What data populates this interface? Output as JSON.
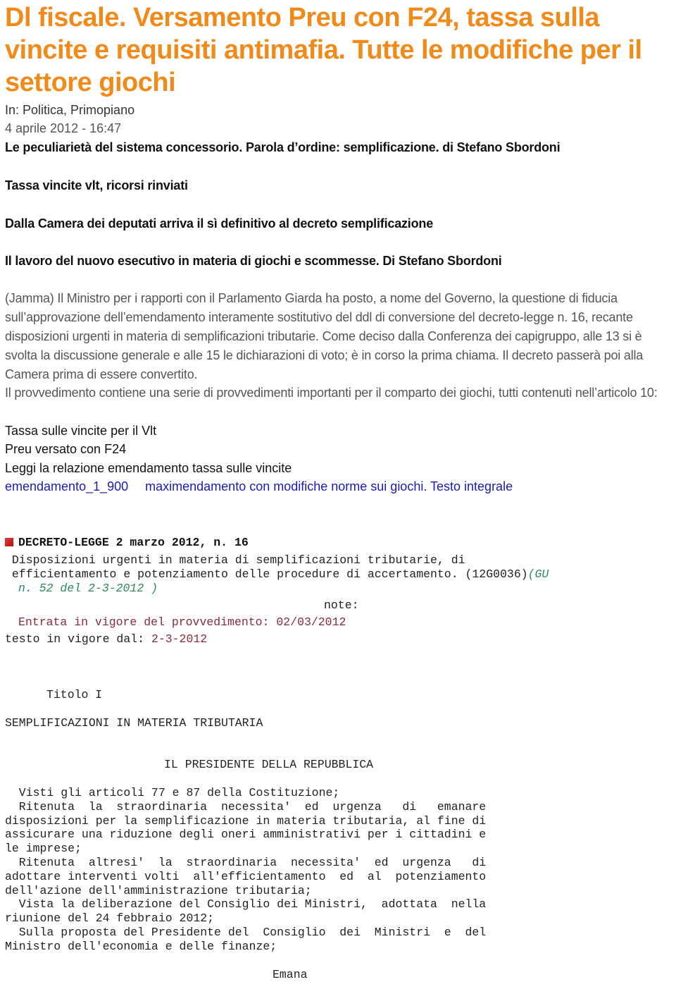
{
  "article": {
    "title": "Dl fiscale. Versamento Preu con F24, tassa sulla vincite e requisiti antimafia. Tutte le modifiche per il settore giochi",
    "categories": "In: Politica, Primopiano",
    "date": "4 aprile 2012 - 16:47",
    "related": [
      "Le peculiarietà del sistema concessorio. Parola d’ordine: semplificazione. di Stefano Sbordoni",
      "Tassa vincite vlt, ricorsi rinviati",
      "Dalla Camera dei deputati arriva il sì definitivo al decreto semplificazione",
      "Il lavoro del nuovo esecutivo in materia di giochi e scommesse. Di Stefano Sbordoni"
    ],
    "body_paragraph_1": "(Jamma)  Il Ministro per i rapporti con il Parlamento Giarda ha posto, a nome del Governo, la questione di fiducia sull’approvazione dell’emendamento interamente sostitutivo del ddl di conversione del decreto-legge n. 16, recante disposizioni urgenti in materia di semplificazioni tributarie. Come deciso dalla Conferenza dei capigruppo, alle 13 si è svolta la discussione generale e alle 15 le dichiarazioni di voto; è in corso la prima chiama. Il decreto passerà poi alla Camera prima di essere convertito.",
    "body_paragraph_2": "Il provvedimento contiene una serie di provvedimenti importanti per il comparto dei giochi, tutti contenuti nell’articolo 10:",
    "items": [
      "Tassa sulle vincite per il Vlt",
      "Preu versato con F24",
      "Leggi la relazione emendamento tassa sulle vincite"
    ],
    "links": [
      "emendamento_1_900",
      "maximendamento con modifiche norme sui giochi. Testo integrale"
    ],
    "link_color": "#1a1ab8",
    "title_color": "#f28a1a"
  },
  "decree": {
    "heading": "DECRETO-LEGGE 2 marzo 2012, n. 16",
    "subtitle_line_1": " Disposizioni urgenti in materia di semplificazioni tributarie, di",
    "subtitle_line_2": " efficientamento e potenziamento delle procedure di accertamento. (12G0036)",
    "gu_ref_part_1": "(GU",
    "gu_ref_part_2": "n. 52 del 2-3-2012 )",
    "note_label": "note:",
    "entry_into_force_label": "Entrata in vigore del provvedimento: 02/03/2012",
    "in_force_label": "testo in vigore dal: ",
    "in_force_date": "2-3-2012",
    "title_section": "Titolo I",
    "section_heading": "SEMPLIFICAZIONI IN MATERIA TRIBUTARIA",
    "president": "IL PRESIDENTE DELLA REPUBBLICA",
    "preamble_lines": [
      "  Visti gli articoli 77 e 87 della Costituzione;",
      "  Ritenuta  la  straordinaria  necessita'  ed  urgenza   di   emanare",
      "disposizioni per la semplificazione in materia tributaria, al fine di",
      "assicurare una riduzione degli oneri amministrativi per i cittadini e",
      "le imprese;",
      "  Ritenuta  altresi'  la  straordinaria  necessita'  ed  urgenza   di",
      "adottare interventi volti  all'efficientamento  ed  al  potenziamento",
      "dell'azione dell'amministrazione tributaria;",
      "  Vista la deliberazione del Consiglio dei Ministri,  adottata  nella",
      "riunione del 24 febbraio 2012;",
      "  Sulla proposta del Presidente del  Consiglio  dei  Ministri  e  del",
      "Ministro dell'economia e delle finanze;"
    ],
    "emana": "Emana"
  }
}
